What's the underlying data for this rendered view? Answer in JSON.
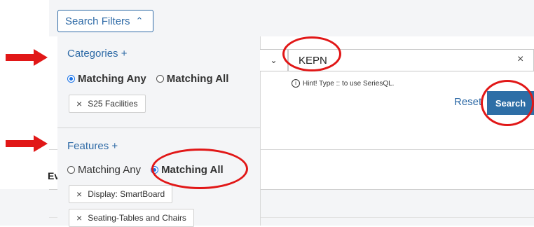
{
  "filters_button": {
    "label": "Search Filters",
    "caret": "^"
  },
  "categories": {
    "title": "Categories +",
    "options": [
      {
        "label": "Matching Any",
        "selected": true
      },
      {
        "label": "Matching All",
        "selected": false
      }
    ],
    "chips": [
      "S25 Facilities"
    ]
  },
  "features": {
    "title": "Features +",
    "options": [
      {
        "label": "Matching Any",
        "selected": false
      },
      {
        "label": "Matching All",
        "selected": true
      }
    ],
    "chips": [
      "Display: SmartBoard",
      "Seating-Tables and Chairs"
    ]
  },
  "search": {
    "value": "KEPN",
    "clear": "×",
    "dropdown_caret": "⌄",
    "hint": "Hint! Type :: to use SeriesQL.",
    "hint_icon": "i"
  },
  "actions": {
    "reset": "Reset",
    "search": "Search"
  },
  "background_text": "Ev",
  "chip_remove": "×",
  "annotation_color": "#e11717"
}
